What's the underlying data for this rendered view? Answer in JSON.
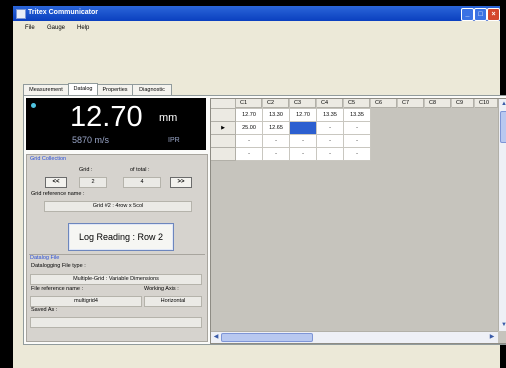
{
  "window": {
    "title": "Tritex Communicator"
  },
  "menu": [
    "File",
    "Gauge",
    "Help"
  ],
  "tabs": [
    "Measurement",
    "Datalog",
    "Properties",
    "Diagnostic"
  ],
  "readout": {
    "value": "12.70",
    "unit": "mm",
    "velocity": "5870 m/s",
    "mode": "IPR"
  },
  "grid_collection": {
    "title": "Grid Collection",
    "grid_label": "Grid :",
    "of_total_label": "of total :",
    "prev": "<<",
    "next": ">>",
    "grid_value": "2",
    "total_value": "4",
    "ref_label": "Grid reference name :",
    "ref_value": "Grid #2 : 4row x 5col"
  },
  "log_button": "Log Reading : Row 2",
  "datalog_file": {
    "title": "Datalog File",
    "type_label": "Datalogging File type :",
    "type_value": "Multiple-Grid : Variable Dimensions",
    "ref_label": "File reference name :",
    "ref_value": "multigrid4",
    "axis_label": "Working Axis :",
    "axis_value": "Horizontal",
    "saved_label": "Saved As :",
    "saved_value": ""
  },
  "table": {
    "columns": [
      "C1",
      "C2",
      "C3",
      "C4",
      "C5",
      "C6",
      "C7",
      "C8",
      "C9",
      "C10"
    ],
    "current_row_marker": "▶",
    "rows": [
      [
        "12.70",
        "13.30",
        "12.70",
        "13.35",
        "13.35"
      ],
      [
        "25.00",
        "12.65",
        "",
        "-",
        "-"
      ],
      [
        "-",
        "-",
        "-",
        "-",
        "-"
      ],
      [
        "-",
        "-",
        "-",
        "-",
        "-"
      ]
    ]
  },
  "colors": {
    "accent": "#2a4fd8",
    "selection": "#2c5fd0",
    "titlebar": "#0a3fbf"
  },
  "icons": {
    "app": "app-icon",
    "minimize": "minimize-icon",
    "maximize": "maximize-icon",
    "close": "close-icon"
  }
}
